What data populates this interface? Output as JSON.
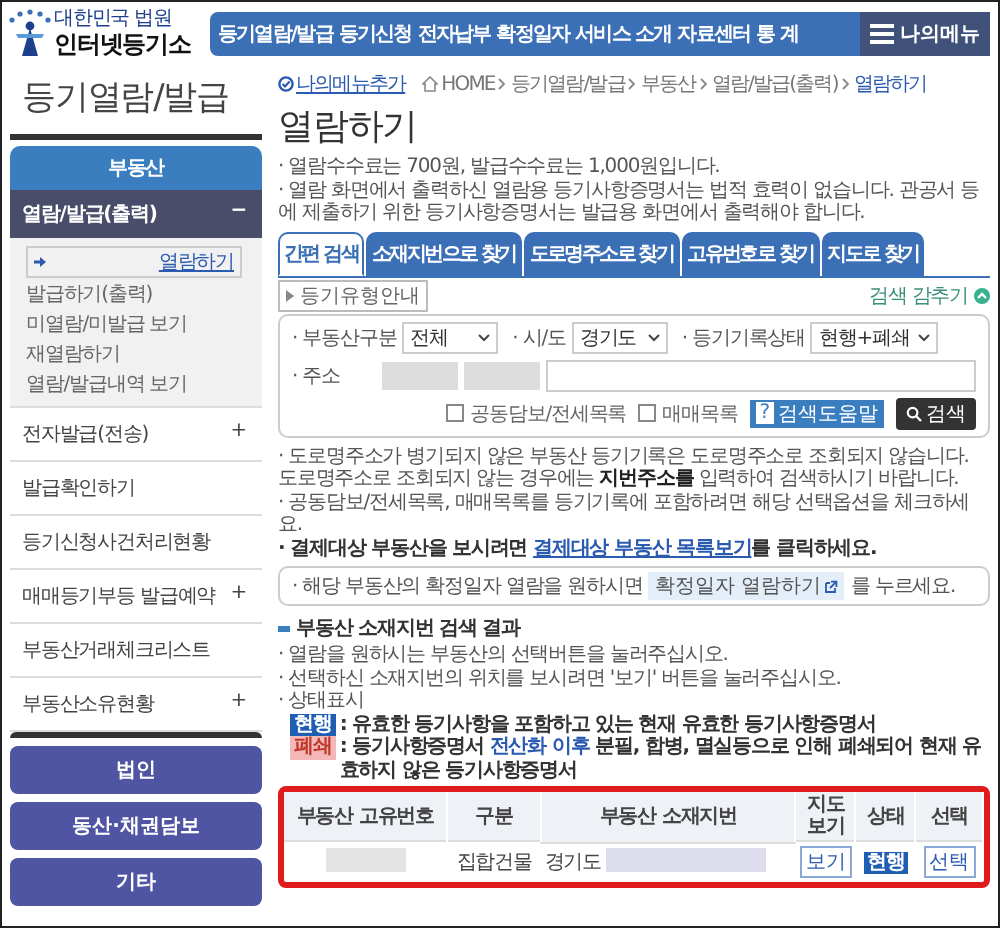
{
  "header": {
    "logo_subtitle": "대한민국 법원",
    "logo_title": "인터넷등기소",
    "nav": [
      "등기열람/발급",
      "등기신청",
      "전자납부",
      "확정일자",
      "서비스 소개",
      "자료센터",
      "통 계"
    ],
    "my_menu": "나의메뉴"
  },
  "sidebar": {
    "title": "등기열람/발급",
    "category": "부동산",
    "group": {
      "label": "열람/발급(출력)",
      "toggle": "−",
      "expanded": true,
      "items": [
        {
          "label": "열람하기",
          "selected": true
        },
        {
          "label": "발급하기(출력)",
          "selected": false
        },
        {
          "label": "미열람/미발급 보기",
          "selected": false
        },
        {
          "label": "재열람하기",
          "selected": false
        },
        {
          "label": "열람/발급내역 보기",
          "selected": false
        }
      ]
    },
    "items": [
      {
        "label": "전자발급(전송)",
        "toggle": "+"
      },
      {
        "label": "발급확인하기"
      },
      {
        "label": "등기신청사건처리현황"
      },
      {
        "label": "매매등기부등 발급예약",
        "toggle": "+"
      },
      {
        "label": "부동산거래체크리스트"
      },
      {
        "label": "부동산소유현황",
        "toggle": "+"
      }
    ],
    "buttons": [
      "법인",
      "동산·채권담보",
      "기타"
    ]
  },
  "breadcrumb": {
    "add_menu": "나의메뉴추가",
    "path": [
      "HOME",
      "등기열람/발급",
      "부동산",
      "열람/발급(출력)",
      "열람하기"
    ]
  },
  "page_title": "열람하기",
  "notices": [
    "· 열람수수료는 700원, 발급수수료는 1,000원입니다.",
    "· 열람 화면에서 출력하신 열람용 등기사항증명서는 법적 효력이 없습니다. 관공서 등에 제출하기 위한 등기사항증명서는 발급용 화면에서 출력해야 합니다."
  ],
  "tabs": [
    {
      "label": "간편 검색",
      "selected": true
    },
    {
      "label": "소재지번으로 찾기",
      "selected": false
    },
    {
      "label": "도로명주소로 찾기",
      "selected": false
    },
    {
      "label": "고유번호로 찾기",
      "selected": false
    },
    {
      "label": "지도로 찾기",
      "selected": false
    }
  ],
  "guide_button": "등기유형안내",
  "hide_search": "검색 감추기",
  "search": {
    "fields": [
      {
        "label": "· 부동산구분",
        "value": "전체"
      },
      {
        "label": "· 시/도",
        "value": "경기도"
      },
      {
        "label": "· 등기기록상태",
        "value": "현행+폐쇄"
      }
    ],
    "address_label": "· 주소",
    "checkboxes": [
      {
        "label": "공동담보/전세목록",
        "checked": false
      },
      {
        "label": "매매목록",
        "checked": false
      }
    ],
    "help_icon": "?",
    "help_button": "검색도움말",
    "search_button": "검색"
  },
  "tips": [
    "· 도로명주소가 병기되지 않은 부동산 등기기록은 도로명주소로 조회되지 않습니다. 도로명주소로 조회되지 않는 경우에는 **지번주소를** 입력하여 검색하시기 바랍니다.",
    "· 공동담보/전세목록, 매매목록를 등기기록에 포함하려면 해당 선택옵션을 체크하세요."
  ],
  "billing_tip": {
    "before": "· 결제대상 부동산을 보시려면 ",
    "link": "결제대상 부동산 목록보기",
    "after": "를 클릭하세요."
  },
  "confirm_box": {
    "before": "· 해당 부동산의 확정일자 열람을 원하시면",
    "button": "확정일자 열람하기",
    "after": "를 누르세요."
  },
  "results": {
    "title": "부동산 소재지번 검색 결과",
    "notes": [
      "· 열람을 원하시는 부동산의 선택버튼을 눌러주십시오.",
      "· 선택하신 소재지번의 위치를 보시려면 '보기' 버튼을 눌러주십시오.",
      "· 상태표시"
    ],
    "legend": [
      {
        "badge": "현행",
        "kind": "current",
        "text": ": 유효한 등기사항을 포함하고 있는 현재 유효한 등기사항증명서"
      },
      {
        "badge": "폐쇄",
        "kind": "closed",
        "text": ": 등기사항증명서 **전산화 이후** 분필, 합병, 멸실등으로 인해 폐쇄되어 현재 유효하지 않은 등기사항증명서"
      }
    ],
    "columns": [
      "부동산 고유번호",
      "구분",
      "부동산 소재지번",
      "지도 보기",
      "상태",
      "선택"
    ],
    "rows": [
      {
        "type": "집합건물",
        "address": "경기도",
        "map_button": "보기",
        "status": {
          "label": "현행",
          "kind": "current"
        },
        "select_button": "선택"
      }
    ]
  }
}
